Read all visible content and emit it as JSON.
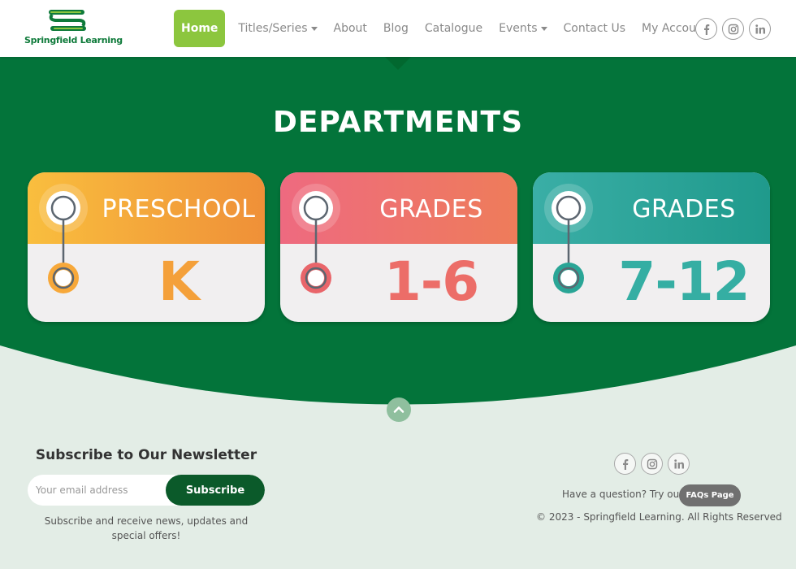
{
  "header": {
    "logo_text": "Springfield Learning",
    "nav": [
      {
        "label": "Home",
        "active": true,
        "dropdown": false
      },
      {
        "label": "Titles/Series",
        "active": false,
        "dropdown": true
      },
      {
        "label": "About",
        "active": false,
        "dropdown": false
      },
      {
        "label": "Blog",
        "active": false,
        "dropdown": false
      },
      {
        "label": "Catalogue",
        "active": false,
        "dropdown": false
      },
      {
        "label": "Events",
        "active": false,
        "dropdown": true
      },
      {
        "label": "Contact Us",
        "active": false,
        "dropdown": false
      },
      {
        "label": "My Account",
        "active": false,
        "dropdown": true
      }
    ],
    "social_icons": [
      "facebook-icon",
      "instagram-icon",
      "linkedin-icon"
    ]
  },
  "departments": {
    "title": "DEPARTMENTS",
    "cards": [
      {
        "label": "PRESCHOOL",
        "grade": "K",
        "color_top": "#f7b63c",
        "color_bottom": "#ef8f3a",
        "accent": "#f49a35"
      },
      {
        "label": "GRADES",
        "grade": "1-6",
        "color_top": "#ef6f7f",
        "color_bottom": "#ee7a5c",
        "accent": "#e9656a"
      },
      {
        "label": "GRADES",
        "grade": "7-12",
        "color_top": "#4bb8b2",
        "color_bottom": "#1f9a8a",
        "accent": "#2aa596"
      }
    ]
  },
  "footer": {
    "newsletter_title": "Subscribe to Our Newsletter",
    "email_placeholder": "Your email address",
    "subscribe_label": "Subscribe",
    "subscribe_note": "Subscribe and receive news, updates and special offers!",
    "question_text": "Have a question? Try our",
    "faq_label": "FAQs Page",
    "copyright": "© 2023 - Springfield Learning. All Rights Reserved",
    "social_icons": [
      "facebook-icon",
      "instagram-icon",
      "linkedin-icon"
    ]
  },
  "colors": {
    "green": "#03743a",
    "dark_green": "#0b5a2a",
    "nav_active": "#8cc63e",
    "footer_bg": "#e3ede6"
  }
}
